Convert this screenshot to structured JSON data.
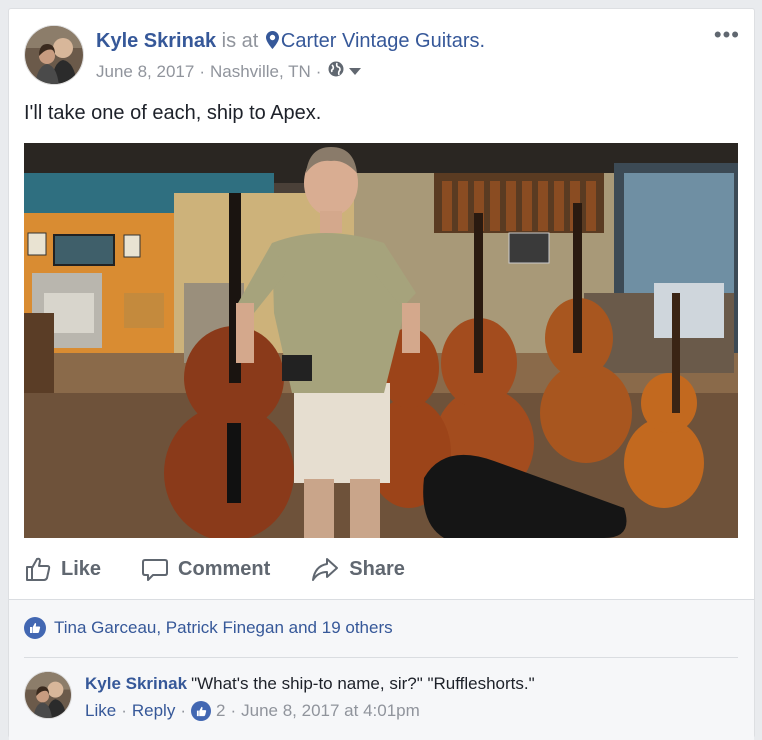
{
  "post": {
    "author": "Kyle Skrinak",
    "is_at": "is at",
    "place": "Carter Vintage Guitars.",
    "date": "June 8, 2017",
    "location": "Nashville, TN",
    "meta_sep": "·",
    "text": "I'll take one of each, ship to Apex.",
    "more_label": "•••"
  },
  "actions": {
    "like": "Like",
    "comment": "Comment",
    "share": "Share"
  },
  "reactions": {
    "text": "Tina Garceau, Patrick Finegan and 19 others"
  },
  "comment": {
    "author": "Kyle Skrinak",
    "text": "\"What's the ship-to name, sir?\" \"Ruffleshorts.\"",
    "like": "Like",
    "reply": "Reply",
    "like_count": "2",
    "timestamp": "June 8, 2017 at 4:01pm",
    "sep": "·"
  },
  "colors": {
    "link": "#365899",
    "muted": "#90949c",
    "accent": "#4267b2"
  }
}
